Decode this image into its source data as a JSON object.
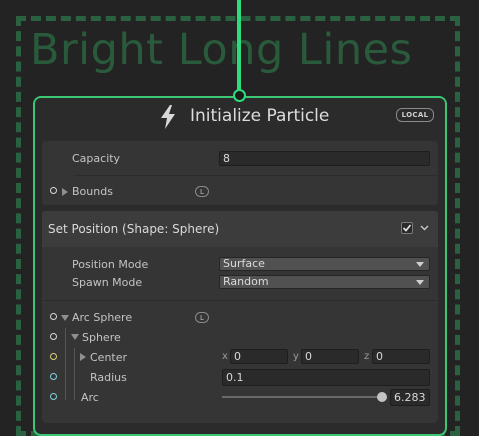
{
  "group": {
    "title": "Bright Long Lines"
  },
  "node": {
    "title": "Initialize Particle",
    "space_badge": "LOCAL"
  },
  "capacity": {
    "label": "Capacity",
    "value": "8"
  },
  "bounds": {
    "label": "Bounds",
    "badge": "L"
  },
  "block": {
    "title": "Set Position (Shape: Sphere)",
    "enabled": true,
    "position_mode": {
      "label": "Position Mode",
      "value": "Surface"
    },
    "spawn_mode": {
      "label": "Spawn Mode",
      "value": "Random"
    },
    "arc_sphere": {
      "label": "Arc Sphere",
      "badge": "L"
    },
    "sphere": {
      "label": "Sphere"
    },
    "center": {
      "label": "Center",
      "x_label": "x",
      "x": "0",
      "y_label": "y",
      "y": "0",
      "z_label": "z",
      "z": "0"
    },
    "radius": {
      "label": "Radius",
      "value": "0.1"
    },
    "arc": {
      "label": "Arc",
      "value": "6.283",
      "fraction": 1.0
    }
  },
  "colors": {
    "accent": "#3cc775",
    "flow": "#2ddc7c",
    "group_title": "#2a5a3c"
  }
}
